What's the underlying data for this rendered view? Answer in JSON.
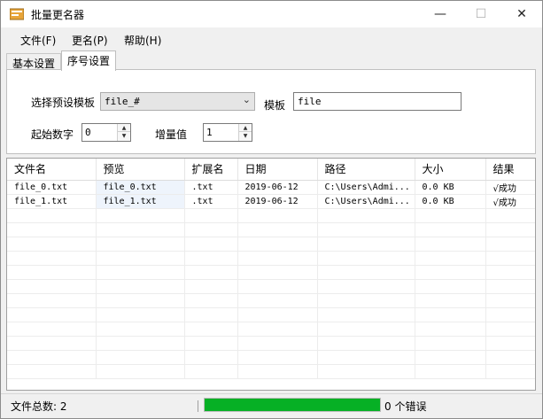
{
  "window": {
    "title": "批量更名器"
  },
  "menu": {
    "items": [
      {
        "label": "文件(F)"
      },
      {
        "label": "更名(P)"
      },
      {
        "label": "帮助(H)"
      }
    ]
  },
  "tabs": [
    {
      "label": "基本设置"
    },
    {
      "label": "序号设置",
      "active": true
    }
  ],
  "settings": {
    "preset_label": "选择预设模板",
    "preset_value": "file_#",
    "template_label": "模板",
    "template_value": "file",
    "start_label": "起始数字",
    "start_value": "0",
    "increment_label": "增量值",
    "increment_value": "1"
  },
  "grid": {
    "columns": [
      "文件名",
      "预览",
      "扩展名",
      "日期",
      "路径",
      "大小",
      "结果"
    ],
    "rows": [
      [
        "file_0.txt",
        "file_0.txt",
        ".txt",
        "2019-06-12",
        "C:\\Users\\Admi...",
        "0.0 KB",
        "√成功"
      ],
      [
        "file_1.txt",
        "file_1.txt",
        ".txt",
        "2019-06-12",
        "C:\\Users\\Admi...",
        "0.0 KB",
        "√成功"
      ]
    ]
  },
  "status": {
    "file_count": "文件总数:  2",
    "progress": 1.0,
    "errors": "0 个错误"
  },
  "colors": {
    "progress_fill": "#06b025",
    "window_bg": "#f0f0f0"
  }
}
